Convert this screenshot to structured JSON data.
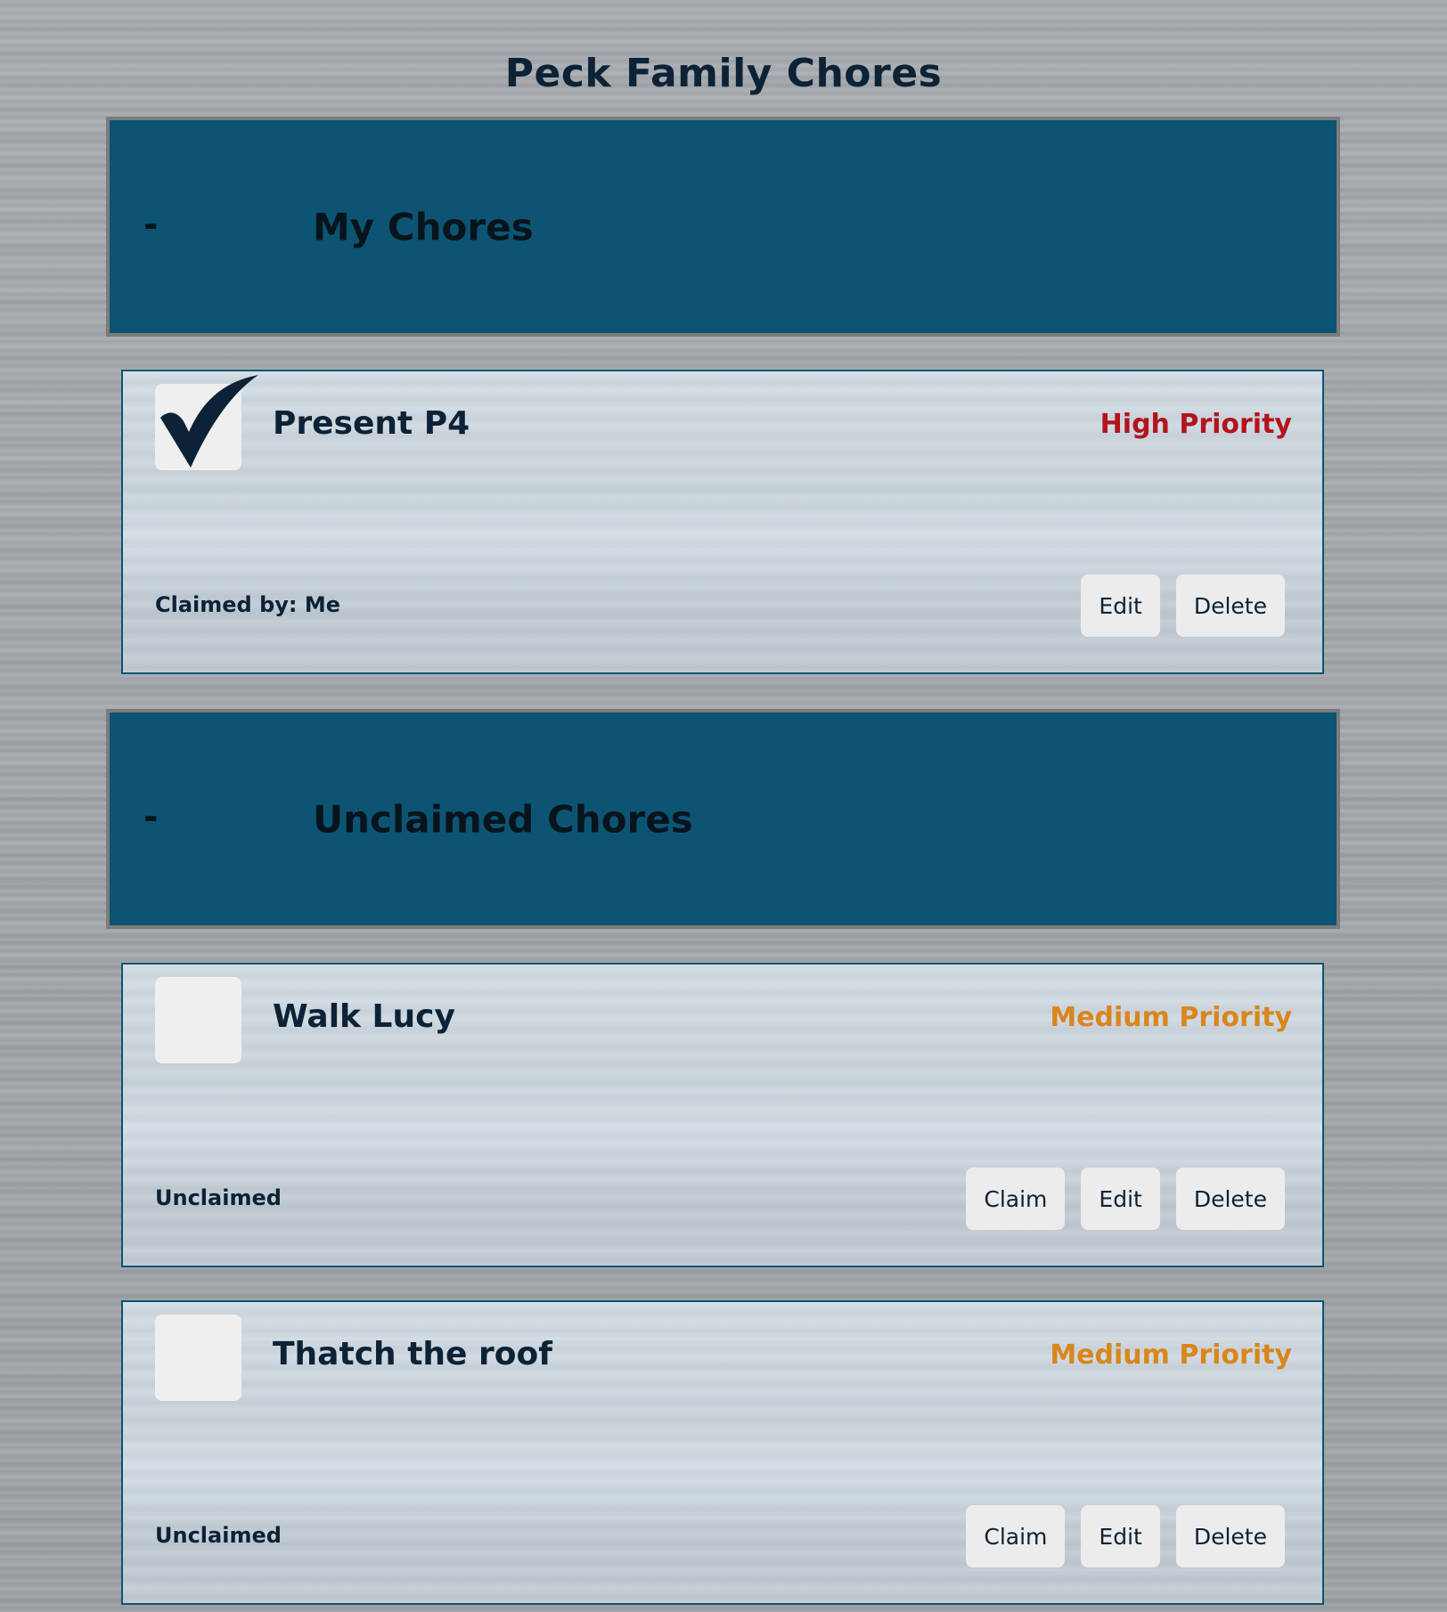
{
  "page": {
    "title": "Peck Family Chores"
  },
  "colors": {
    "section_header_bg": "#0d5473",
    "priority_high": "#b3141c",
    "priority_medium": "#d9861c",
    "text_dark": "#0c2236"
  },
  "sections": [
    {
      "toggle": "-",
      "title": "My Chores",
      "chores": [
        {
          "name": "Present P4",
          "checked": true,
          "checkbox_icon": "checkmark-icon",
          "priority": "High Priority",
          "status": "Claimed by: Me",
          "buttons": {
            "edit": "Edit",
            "delete": "Delete"
          }
        }
      ]
    },
    {
      "toggle": "-",
      "title": "Unclaimed Chores",
      "chores": [
        {
          "name": "Walk Lucy",
          "checked": false,
          "priority": "Medium Priority",
          "status": "Unclaimed",
          "buttons": {
            "claim": "Claim",
            "edit": "Edit",
            "delete": "Delete"
          }
        },
        {
          "name": "Thatch the roof",
          "checked": false,
          "priority": "Medium Priority",
          "status": "Unclaimed",
          "buttons": {
            "claim": "Claim",
            "edit": "Edit",
            "delete": "Delete"
          }
        }
      ]
    }
  ]
}
